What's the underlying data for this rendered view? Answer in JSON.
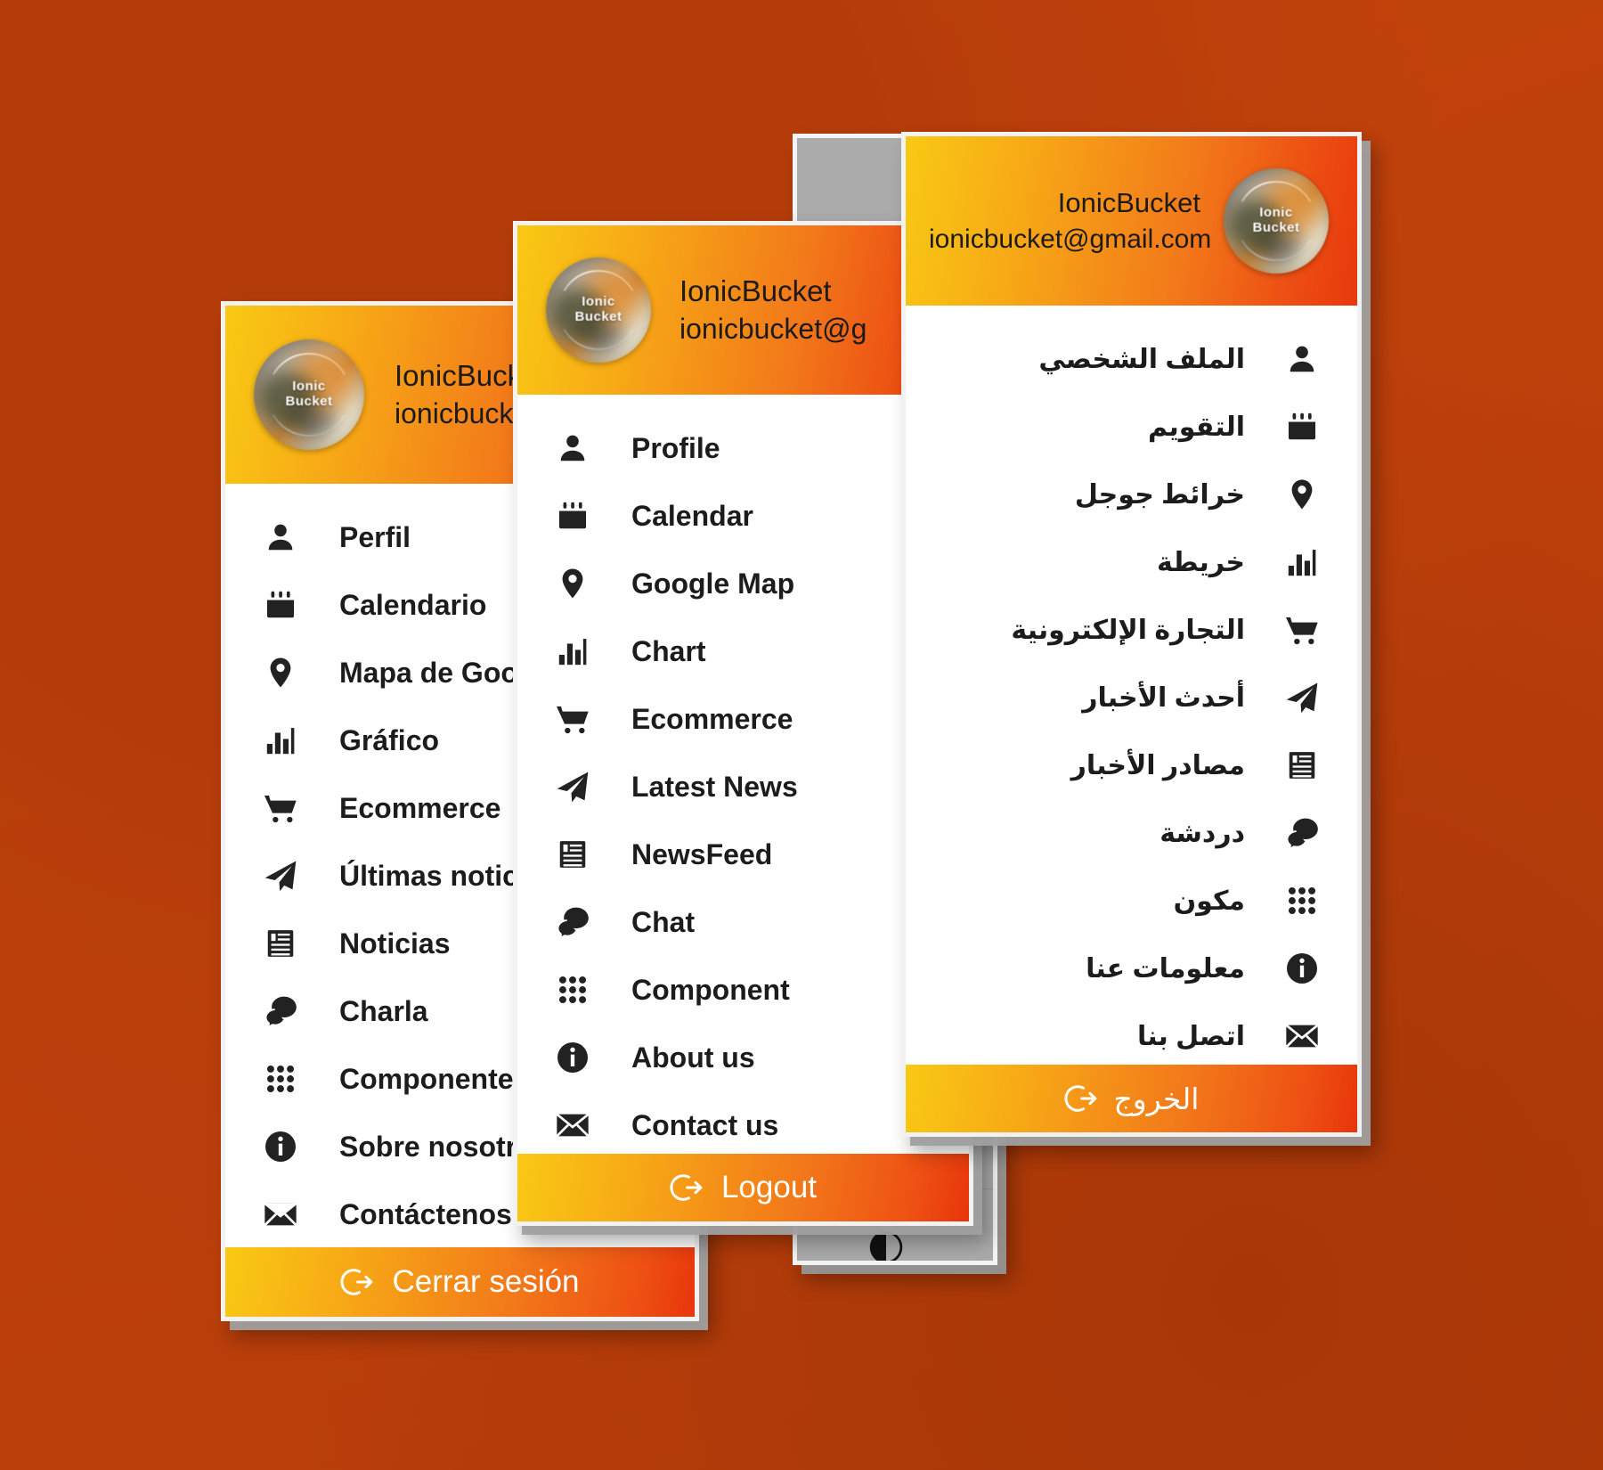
{
  "app": {
    "brand_name": "IonicBucket",
    "brand_avatar_line1": "Ionic",
    "brand_avatar_line2": "Bucket",
    "email": "ionicbucket@gmail.com",
    "email_truncated_es": "ionicbucket@g",
    "email_truncated_en": "ionicbucket@g",
    "colors": {
      "background": "#c4410c",
      "gradient_start": "#f9c914",
      "gradient_mid": "#f2781a",
      "gradient_end": "#e8350b",
      "toggle_on": "#c2310a",
      "check_mark": "#c23b12",
      "icon": "#1c1c1c",
      "panel_border": "#f2f2f2",
      "settings_panel_bg": "#ababab"
    }
  },
  "panel_spanish": {
    "language": "Spanish",
    "header": {
      "name": "IonicBucket",
      "email": "ionicbucket@g"
    },
    "items": [
      {
        "label": "Perfil",
        "icon": "person-icon"
      },
      {
        "label": "Calendario",
        "icon": "calendar-icon"
      },
      {
        "label": "Mapa de Google",
        "icon": "map-pin-icon"
      },
      {
        "label": "Gráfico",
        "icon": "bar-chart-icon"
      },
      {
        "label": "Ecommerce",
        "icon": "shopping-cart-icon"
      },
      {
        "label": "Últimas noticias",
        "icon": "paper-plane-icon"
      },
      {
        "label": "Noticias",
        "icon": "newspaper-icon"
      },
      {
        "label": "Charla",
        "icon": "chat-bubble-icon"
      },
      {
        "label": "Componente",
        "icon": "grid-dots-icon"
      },
      {
        "label": "Sobre nosotros",
        "icon": "info-circle-icon"
      },
      {
        "label": "Contáctenos",
        "icon": "envelope-icon"
      }
    ],
    "logout_label": "Cerrar sesión"
  },
  "panel_english": {
    "language": "English",
    "header": {
      "name": "IonicBucket",
      "email": "ionicbucket@g"
    },
    "items": [
      {
        "label": "Profile",
        "icon": "person-icon"
      },
      {
        "label": "Calendar",
        "icon": "calendar-icon"
      },
      {
        "label": "Google Map",
        "icon": "map-pin-icon"
      },
      {
        "label": "Chart",
        "icon": "bar-chart-icon"
      },
      {
        "label": "Ecommerce",
        "icon": "shopping-cart-icon"
      },
      {
        "label": "Latest News",
        "icon": "paper-plane-icon"
      },
      {
        "label": "NewsFeed",
        "icon": "newspaper-icon"
      },
      {
        "label": "Chat",
        "icon": "chat-bubble-icon"
      },
      {
        "label": "Component",
        "icon": "grid-dots-icon"
      },
      {
        "label": "About us",
        "icon": "info-circle-icon"
      },
      {
        "label": "Contact us",
        "icon": "envelope-icon"
      }
    ],
    "logout_label": "Logout"
  },
  "panel_arabic": {
    "language": "Arabic",
    "header": {
      "name": "IonicBucket",
      "email": "ionicbucket@gmail.com"
    },
    "items": [
      {
        "label": "الملف الشخصي",
        "icon": "person-icon"
      },
      {
        "label": "التقويم",
        "icon": "calendar-icon"
      },
      {
        "label": "خرائط جوجل",
        "icon": "map-pin-icon"
      },
      {
        "label": "خريطة",
        "icon": "bar-chart-icon"
      },
      {
        "label": "التجارة الإلكترونية",
        "icon": "shopping-cart-icon"
      },
      {
        "label": "أحدث الأخبار",
        "icon": "paper-plane-icon"
      },
      {
        "label": "مصادر الأخبار",
        "icon": "newspaper-icon"
      },
      {
        "label": "دردشة",
        "icon": "chat-bubble-icon"
      },
      {
        "label": "مكون",
        "icon": "grid-dots-icon"
      },
      {
        "label": "معلومات عنا",
        "icon": "info-circle-icon"
      },
      {
        "label": "اتصل بنا",
        "icon": "envelope-icon"
      }
    ],
    "logout_label": "الخروج"
  },
  "panel_settings": {
    "rows": [
      {
        "control": "none"
      },
      {
        "control": "none"
      },
      {
        "control": "check",
        "value": "✓"
      },
      {
        "control": "none"
      },
      {
        "control": "toggle",
        "state": "on"
      },
      {
        "control": "toggle",
        "state": "off"
      },
      {
        "control": "toggle",
        "state": "on"
      },
      {
        "control": "none"
      },
      {
        "control": "icon",
        "icon": "brightness-sun-icon"
      },
      {
        "control": "icon",
        "icon": "contrast-half-icon"
      },
      {
        "control": "icon",
        "icon": "contrast-half-icon"
      }
    ]
  }
}
